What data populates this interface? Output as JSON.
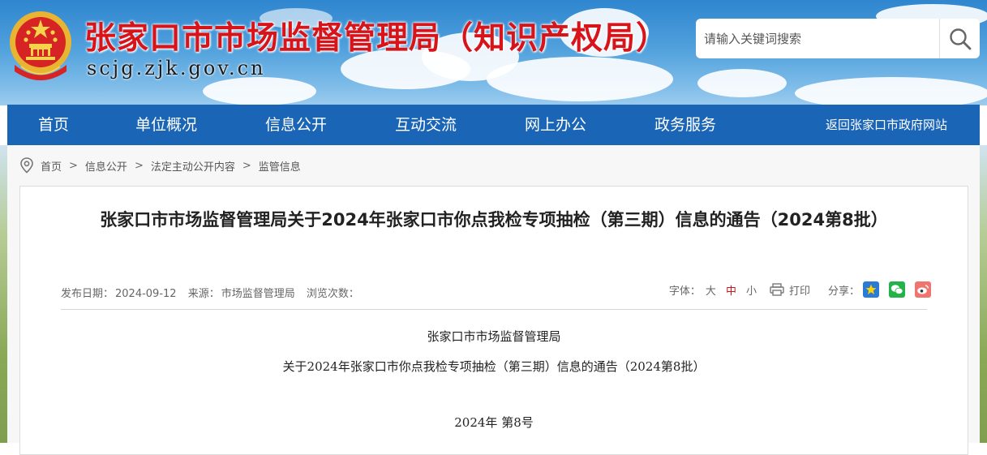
{
  "header": {
    "title": "张家口市市场监督管理局（知识产权局）",
    "url": "scjg.zjk.gov.cn",
    "search": {
      "placeholder": "请输入关键词搜索"
    }
  },
  "nav": {
    "items": [
      {
        "label": "首页"
      },
      {
        "label": "单位概况"
      },
      {
        "label": "信息公开"
      },
      {
        "label": "互动交流"
      },
      {
        "label": "网上办公"
      },
      {
        "label": "政务服务"
      }
    ],
    "return_link": "返回张家口市政府网站"
  },
  "breadcrumb": {
    "items": [
      {
        "label": "首页"
      },
      {
        "label": "信息公开"
      },
      {
        "label": "法定主动公开内容"
      },
      {
        "label": "监管信息"
      }
    ],
    "separator": ">"
  },
  "article": {
    "title": "张家口市市场监督管理局关于2024年张家口市你点我检专项抽检（第三期）信息的通告（2024第8批）",
    "meta": {
      "date_label": "发布日期：",
      "date": "2024-09-12",
      "source_label": "来源：",
      "source": "市场监督管理局",
      "views_label": "浏览次数："
    },
    "tools": {
      "font_label": "字体：",
      "font_large": "大",
      "font_medium": "中",
      "font_small": "小",
      "print_label": "打印",
      "share_label": "分享："
    },
    "body": {
      "line1": "张家口市市场监督管理局",
      "line2": "关于2024年张家口市你点我检专项抽检（第三期）信息的通告（2024第8批）",
      "line3": "2024年 第8号"
    }
  },
  "colors": {
    "title_red": "#d8141b",
    "nav_blue": "#1a65b5",
    "font_active": "#c9151e"
  }
}
